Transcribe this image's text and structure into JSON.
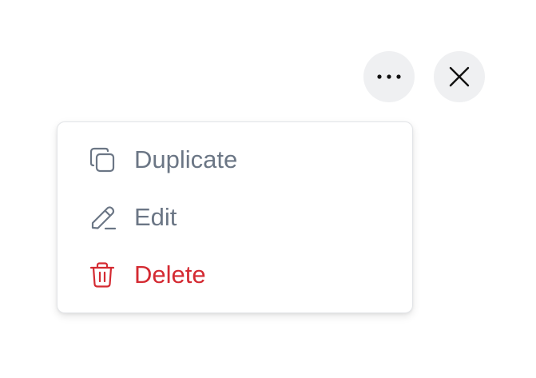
{
  "header": {
    "more_icon": "more-horizontal-icon",
    "close_icon": "close-icon"
  },
  "menu": {
    "items": [
      {
        "label": "Duplicate",
        "icon": "duplicate-icon",
        "color": "#6b7685"
      },
      {
        "label": "Edit",
        "icon": "edit-pencil-icon",
        "color": "#6b7685"
      },
      {
        "label": "Delete",
        "icon": "trash-icon",
        "color": "#d42a32"
      }
    ]
  },
  "colors": {
    "button_bg": "#eff0f2",
    "icon_dark": "#111111",
    "menu_text": "#6b7685",
    "danger": "#d42a32",
    "menu_border": "#e3e5e8"
  }
}
